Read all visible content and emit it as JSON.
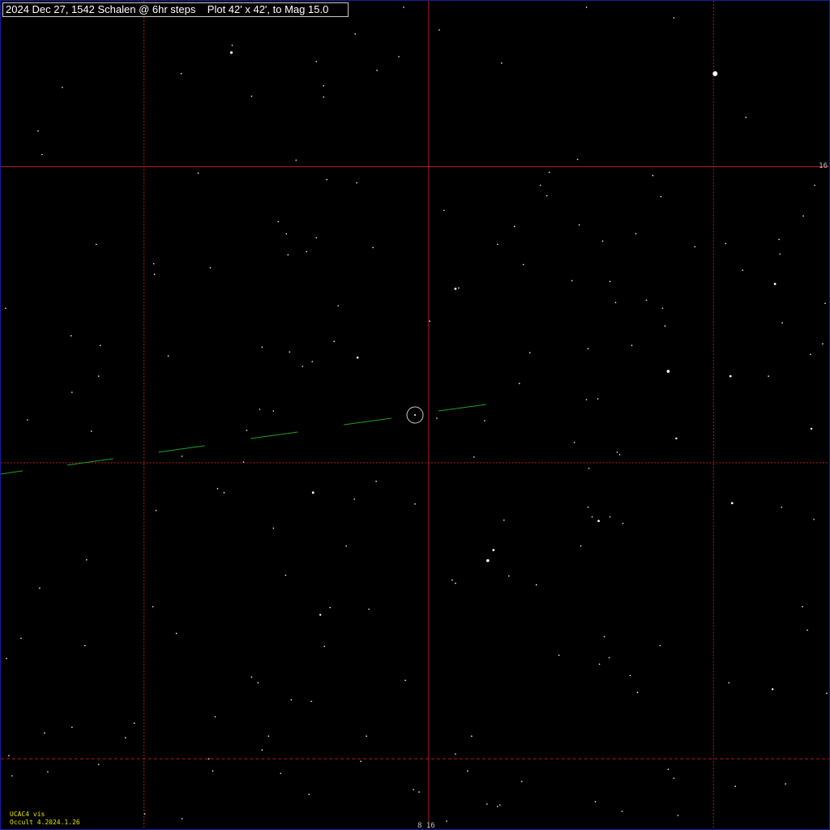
{
  "title": "2024 Dec 27, 1542 Schalen @ 6hr steps    Plot 42' x 42', to Mag 15.0",
  "axes": {
    "dec_tick_label": "16",
    "ra_tick_label": "8 16"
  },
  "footer": {
    "catalog": "UCAC4 vis",
    "version": "Occult 4.2024.1.26"
  },
  "colors": {
    "background": "#000000",
    "grid": "#b41e1e",
    "path": "#1ea01e",
    "stars": "#ffffff",
    "footer_text": "#e6e600",
    "border": "#1a1aa8"
  },
  "markers": {
    "target": "circle-marker"
  }
}
